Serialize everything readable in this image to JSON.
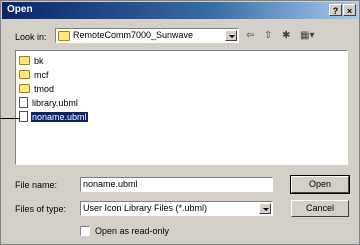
{
  "window": {
    "title": "Open",
    "help_glyph": "?",
    "close_glyph": "×"
  },
  "lookin": {
    "label": "Look in:",
    "value": "RemoteComm7000_Sunwave"
  },
  "toolbar": {
    "back": "⇦",
    "up": "⇧",
    "newfolder": "✱",
    "view": "▦▾"
  },
  "files": [
    {
      "name": "bk",
      "type": "folder",
      "selected": false
    },
    {
      "name": "mcf",
      "type": "folder",
      "selected": false
    },
    {
      "name": "tmod",
      "type": "folder",
      "selected": false
    },
    {
      "name": "library.ubml",
      "type": "file",
      "selected": false
    },
    {
      "name": "noname.ubml",
      "type": "file",
      "selected": true
    }
  ],
  "filename": {
    "label": "File name:",
    "value": "noname.ubml"
  },
  "filetype": {
    "label": "Files of type:",
    "value": "User Icon Library Files (*.ubml)"
  },
  "readonly": {
    "label": "Open as read-only"
  },
  "buttons": {
    "open": "Open",
    "cancel": "Cancel"
  }
}
